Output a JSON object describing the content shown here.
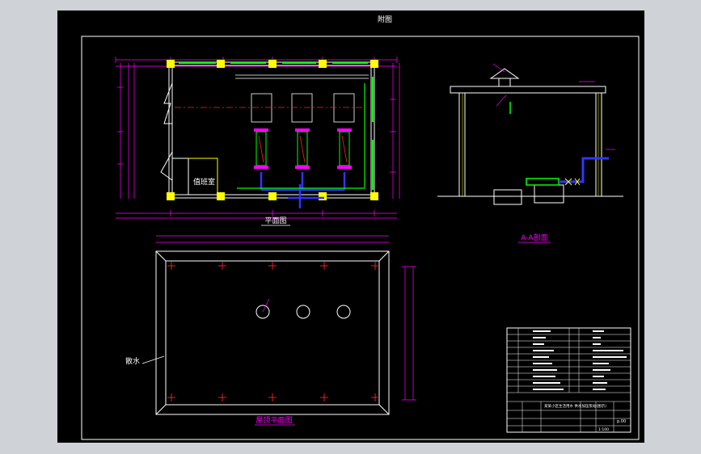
{
  "sheet": {
    "header_title": "附图",
    "labels": {
      "plan_title": "平面图",
      "roof_title": "屋顶平面图",
      "section_title": "A-A剖面",
      "room_label": "值班室",
      "drainage_note": "散水"
    }
  },
  "title_block": {
    "title_row": "某某小区生活用水 供水加压泵站(图示)",
    "drawing_no": "p.00",
    "scale": "1:100"
  },
  "colors": {
    "wall": "#ffffff",
    "dimension": "#ff00ff",
    "column": "#ffff00",
    "pipe": "#00ff00",
    "water_pipe": "#3333ff",
    "axis": "#ff2020",
    "text": "#ffffff"
  }
}
